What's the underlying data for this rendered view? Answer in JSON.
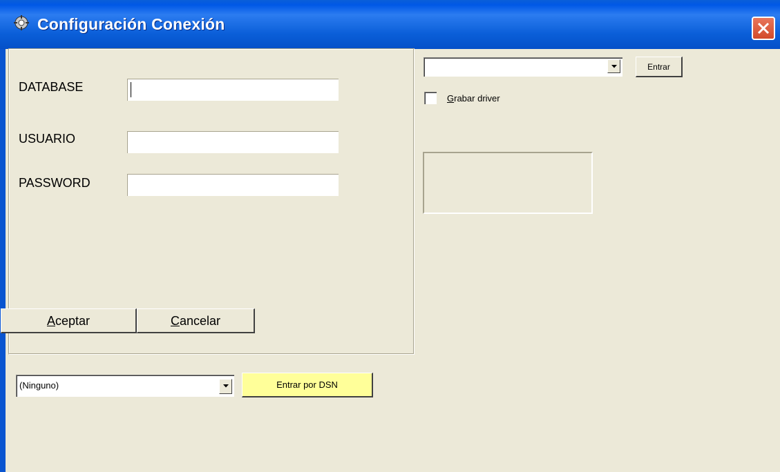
{
  "window": {
    "title": "Configuración Conexión"
  },
  "form": {
    "database_label": "DATABASE",
    "usuario_label": "USUARIO",
    "password_label": "PASSWORD",
    "database_value": "",
    "usuario_value": "",
    "password_value": ""
  },
  "buttons": {
    "aceptar_first": "A",
    "aceptar_rest": "ceptar",
    "cancelar_first": "C",
    "cancelar_rest": "ancelar",
    "entrar": "Entrar",
    "entrar_dsn": "Entrar por DSN"
  },
  "driver": {
    "combo_value": "",
    "grabar_first": "G",
    "grabar_rest": "rabar driver"
  },
  "dsn": {
    "combo_value": "(Ninguno)"
  },
  "colors": {
    "dsn_button": "#FFFF99",
    "title_bar": "#0A5ED8",
    "face": "#ECE9D8"
  },
  "icons": {
    "title": "gear-icon",
    "close": "close-icon",
    "dropdown": "chevron-down-icon"
  }
}
